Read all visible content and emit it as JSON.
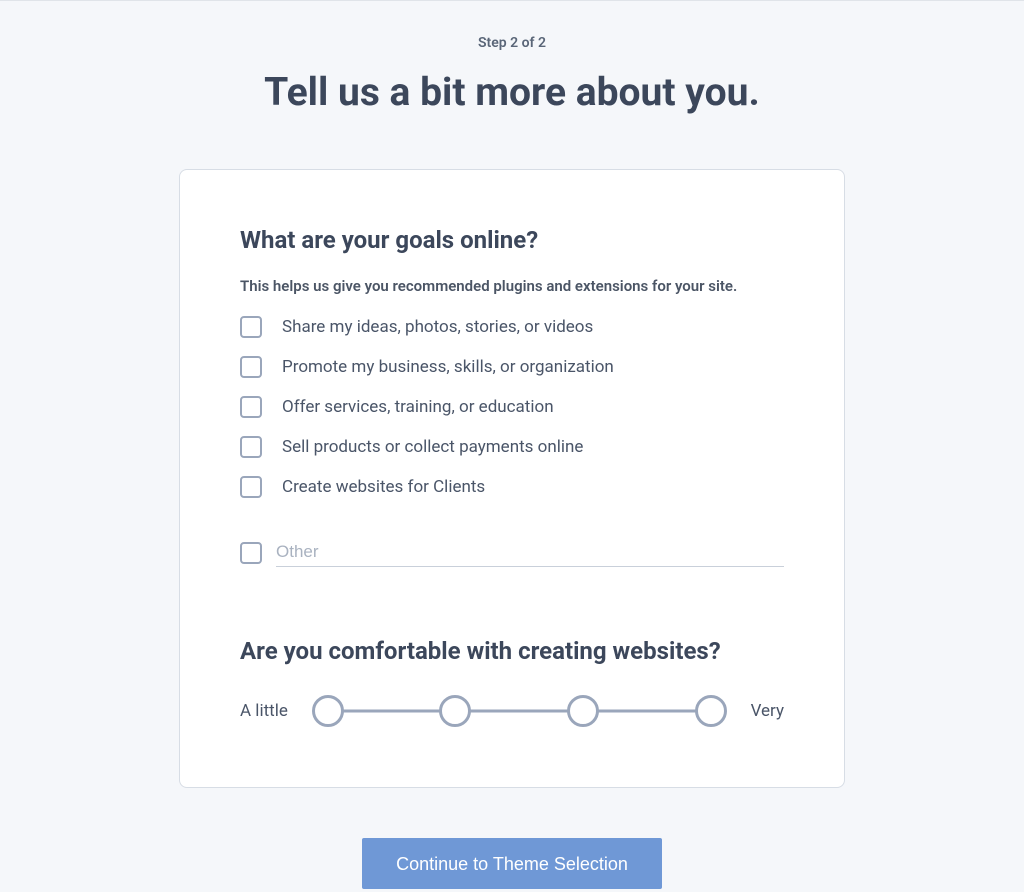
{
  "step_indicator": "Step 2 of 2",
  "page_title": "Tell us a bit more about you.",
  "goals": {
    "heading": "What are your goals online?",
    "description": "This helps us give you recommended plugins and extensions for your site.",
    "options": [
      "Share my ideas, photos, stories, or videos",
      "Promote my business, skills, or organization",
      "Offer services, training, or education",
      "Sell products or collect payments online",
      "Create websites for Clients"
    ],
    "other_placeholder": "Other"
  },
  "comfort": {
    "heading": "Are you comfortable with creating websites?",
    "min_label": "A little",
    "max_label": "Very"
  },
  "cta_label": "Continue to Theme Selection"
}
